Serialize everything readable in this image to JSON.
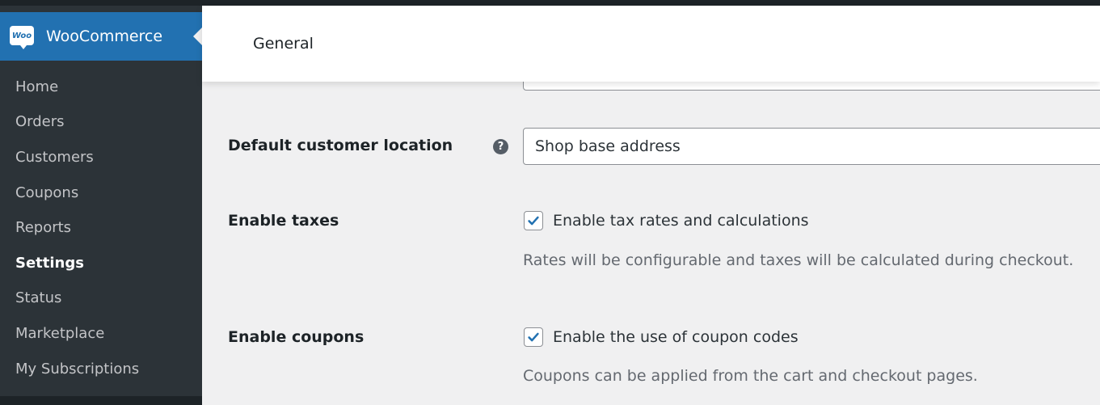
{
  "sidebar": {
    "brand": "WooCommerce",
    "logo_text": "Woo",
    "items": [
      {
        "label": "Home"
      },
      {
        "label": "Orders"
      },
      {
        "label": "Customers"
      },
      {
        "label": "Coupons"
      },
      {
        "label": "Reports"
      },
      {
        "label": "Settings",
        "active": true
      },
      {
        "label": "Status"
      },
      {
        "label": "Marketplace"
      },
      {
        "label": "My Subscriptions"
      }
    ]
  },
  "header": {
    "title": "General"
  },
  "settings": {
    "customer_location": {
      "label": "Default customer location",
      "value": "Shop base address",
      "help": "?"
    },
    "taxes": {
      "label": "Enable taxes",
      "checkbox_label": "Enable tax rates and calculations",
      "checked": true,
      "description": "Rates will be configurable and taxes will be calculated during checkout."
    },
    "coupons": {
      "label": "Enable coupons",
      "checkbox_label": "Enable the use of coupon codes",
      "checked": true,
      "description": "Coupons can be applied from the cart and checkout pages."
    }
  },
  "colors": {
    "accent": "#2271b1",
    "sidebar_bg": "#2c3338",
    "check": "#2271b1"
  }
}
